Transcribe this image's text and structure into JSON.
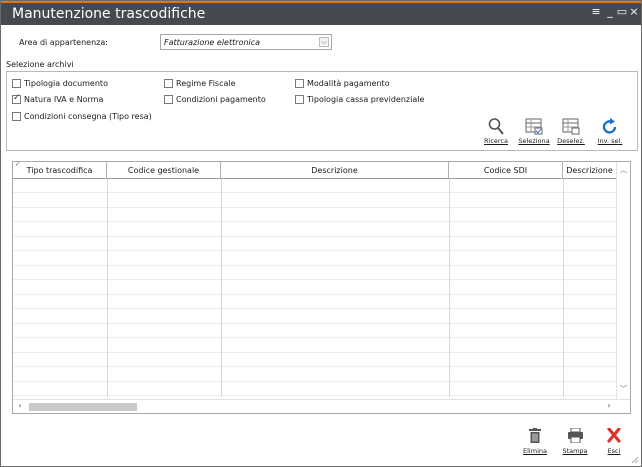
{
  "window": {
    "title": "Manutenzione trascodifiche",
    "controls": [
      "≡",
      "_",
      "▭",
      "×"
    ]
  },
  "area": {
    "label": "Area di appartenenza:",
    "selected": "Fatturazione elettronica"
  },
  "selezione": {
    "label": "Selezione archivi",
    "checkboxes": [
      {
        "label": "Tipologia documento",
        "checked": false
      },
      {
        "label": "Regime Fiscale",
        "checked": false
      },
      {
        "label": "Modalità pagamento",
        "checked": false
      },
      {
        "label": "Natura IVA e Norma",
        "checked": true
      },
      {
        "label": "Condizioni pagamento",
        "checked": false
      },
      {
        "label": "Tipologia cassa previdenziale",
        "checked": false
      },
      {
        "label": "Condizioni consegna (Tipo resa)",
        "checked": false
      }
    ]
  },
  "toolbar": {
    "ricerca": "Ricerca",
    "seleziona": "Seleziona",
    "deselez": "Deselez.",
    "inv_sel": "Inv. sel."
  },
  "grid": {
    "columns": [
      "Tipo trascodifica",
      "Codice gestionale",
      "Descrizione",
      "Codice SDI",
      "Descrizione"
    ],
    "rows": []
  },
  "actions": {
    "elimina": "Elimina",
    "stampa": "Stampa",
    "esci": "Esci"
  },
  "colors": {
    "titlebar": "#444a4f",
    "accent": "#e8740c",
    "refresh_icon": "#1f6fc8",
    "delete_red": "#d9342b"
  }
}
